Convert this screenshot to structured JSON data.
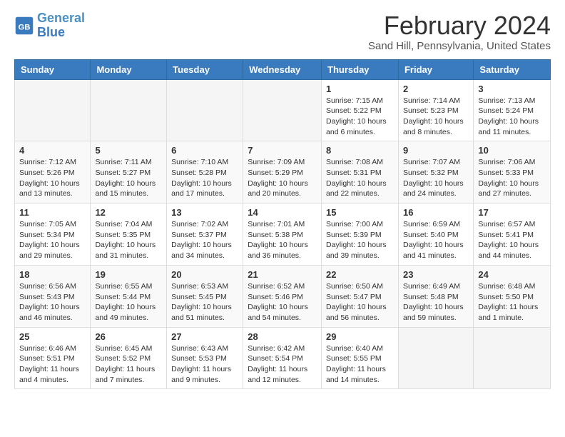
{
  "logo": {
    "line1": "General",
    "line2": "Blue"
  },
  "title": "February 2024",
  "location": "Sand Hill, Pennsylvania, United States",
  "days_of_week": [
    "Sunday",
    "Monday",
    "Tuesday",
    "Wednesday",
    "Thursday",
    "Friday",
    "Saturday"
  ],
  "weeks": [
    [
      {
        "day": "",
        "detail": ""
      },
      {
        "day": "",
        "detail": ""
      },
      {
        "day": "",
        "detail": ""
      },
      {
        "day": "",
        "detail": ""
      },
      {
        "day": "1",
        "detail": "Sunrise: 7:15 AM\nSunset: 5:22 PM\nDaylight: 10 hours\nand 6 minutes."
      },
      {
        "day": "2",
        "detail": "Sunrise: 7:14 AM\nSunset: 5:23 PM\nDaylight: 10 hours\nand 8 minutes."
      },
      {
        "day": "3",
        "detail": "Sunrise: 7:13 AM\nSunset: 5:24 PM\nDaylight: 10 hours\nand 11 minutes."
      }
    ],
    [
      {
        "day": "4",
        "detail": "Sunrise: 7:12 AM\nSunset: 5:26 PM\nDaylight: 10 hours\nand 13 minutes."
      },
      {
        "day": "5",
        "detail": "Sunrise: 7:11 AM\nSunset: 5:27 PM\nDaylight: 10 hours\nand 15 minutes."
      },
      {
        "day": "6",
        "detail": "Sunrise: 7:10 AM\nSunset: 5:28 PM\nDaylight: 10 hours\nand 17 minutes."
      },
      {
        "day": "7",
        "detail": "Sunrise: 7:09 AM\nSunset: 5:29 PM\nDaylight: 10 hours\nand 20 minutes."
      },
      {
        "day": "8",
        "detail": "Sunrise: 7:08 AM\nSunset: 5:31 PM\nDaylight: 10 hours\nand 22 minutes."
      },
      {
        "day": "9",
        "detail": "Sunrise: 7:07 AM\nSunset: 5:32 PM\nDaylight: 10 hours\nand 24 minutes."
      },
      {
        "day": "10",
        "detail": "Sunrise: 7:06 AM\nSunset: 5:33 PM\nDaylight: 10 hours\nand 27 minutes."
      }
    ],
    [
      {
        "day": "11",
        "detail": "Sunrise: 7:05 AM\nSunset: 5:34 PM\nDaylight: 10 hours\nand 29 minutes."
      },
      {
        "day": "12",
        "detail": "Sunrise: 7:04 AM\nSunset: 5:35 PM\nDaylight: 10 hours\nand 31 minutes."
      },
      {
        "day": "13",
        "detail": "Sunrise: 7:02 AM\nSunset: 5:37 PM\nDaylight: 10 hours\nand 34 minutes."
      },
      {
        "day": "14",
        "detail": "Sunrise: 7:01 AM\nSunset: 5:38 PM\nDaylight: 10 hours\nand 36 minutes."
      },
      {
        "day": "15",
        "detail": "Sunrise: 7:00 AM\nSunset: 5:39 PM\nDaylight: 10 hours\nand 39 minutes."
      },
      {
        "day": "16",
        "detail": "Sunrise: 6:59 AM\nSunset: 5:40 PM\nDaylight: 10 hours\nand 41 minutes."
      },
      {
        "day": "17",
        "detail": "Sunrise: 6:57 AM\nSunset: 5:41 PM\nDaylight: 10 hours\nand 44 minutes."
      }
    ],
    [
      {
        "day": "18",
        "detail": "Sunrise: 6:56 AM\nSunset: 5:43 PM\nDaylight: 10 hours\nand 46 minutes."
      },
      {
        "day": "19",
        "detail": "Sunrise: 6:55 AM\nSunset: 5:44 PM\nDaylight: 10 hours\nand 49 minutes."
      },
      {
        "day": "20",
        "detail": "Sunrise: 6:53 AM\nSunset: 5:45 PM\nDaylight: 10 hours\nand 51 minutes."
      },
      {
        "day": "21",
        "detail": "Sunrise: 6:52 AM\nSunset: 5:46 PM\nDaylight: 10 hours\nand 54 minutes."
      },
      {
        "day": "22",
        "detail": "Sunrise: 6:50 AM\nSunset: 5:47 PM\nDaylight: 10 hours\nand 56 minutes."
      },
      {
        "day": "23",
        "detail": "Sunrise: 6:49 AM\nSunset: 5:48 PM\nDaylight: 10 hours\nand 59 minutes."
      },
      {
        "day": "24",
        "detail": "Sunrise: 6:48 AM\nSunset: 5:50 PM\nDaylight: 11 hours\nand 1 minute."
      }
    ],
    [
      {
        "day": "25",
        "detail": "Sunrise: 6:46 AM\nSunset: 5:51 PM\nDaylight: 11 hours\nand 4 minutes."
      },
      {
        "day": "26",
        "detail": "Sunrise: 6:45 AM\nSunset: 5:52 PM\nDaylight: 11 hours\nand 7 minutes."
      },
      {
        "day": "27",
        "detail": "Sunrise: 6:43 AM\nSunset: 5:53 PM\nDaylight: 11 hours\nand 9 minutes."
      },
      {
        "day": "28",
        "detail": "Sunrise: 6:42 AM\nSunset: 5:54 PM\nDaylight: 11 hours\nand 12 minutes."
      },
      {
        "day": "29",
        "detail": "Sunrise: 6:40 AM\nSunset: 5:55 PM\nDaylight: 11 hours\nand 14 minutes."
      },
      {
        "day": "",
        "detail": ""
      },
      {
        "day": "",
        "detail": ""
      }
    ]
  ]
}
